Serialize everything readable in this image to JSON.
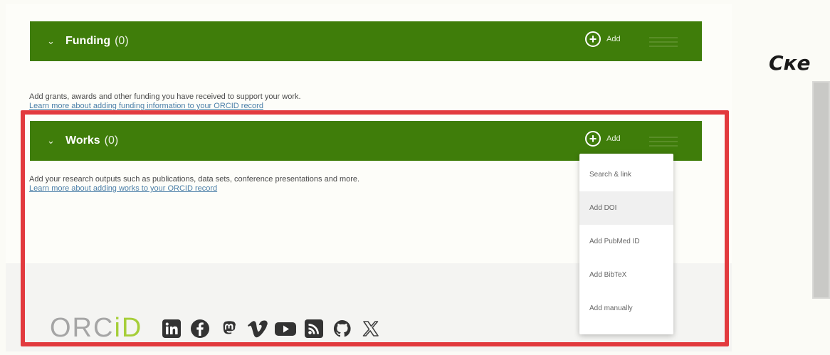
{
  "funding": {
    "title": "Funding",
    "count": "(0)",
    "add_label": "Add",
    "description": "Add grants, awards and other funding you have received to support your work.",
    "link": "Learn more about adding funding information to your ORCID record"
  },
  "works": {
    "title": "Works",
    "count": "(0)",
    "add_label": "Add",
    "description": "Add your research outputs such as publications, data sets, conference presentations and more.",
    "link": "Learn more about adding works to your ORCID record"
  },
  "add_menu": {
    "items": [
      "Search & link",
      "Add DOI",
      "Add PubMed ID",
      "Add BibTeX",
      "Add manually"
    ]
  },
  "footer": {
    "logo_prefix": "ORC",
    "logo_i": "i",
    "logo_suffix": "D",
    "social": [
      "linkedin-icon",
      "facebook-icon",
      "mastodon-icon",
      "vimeo-icon",
      "youtube-icon",
      "rss-icon",
      "github-icon",
      "x-icon"
    ]
  },
  "right": {
    "title": "Ске"
  },
  "colors": {
    "section_header": "#3f7d0a",
    "highlight": "#e23a3e",
    "link": "#4b7fa8",
    "orcid_green": "#a6ce39"
  }
}
